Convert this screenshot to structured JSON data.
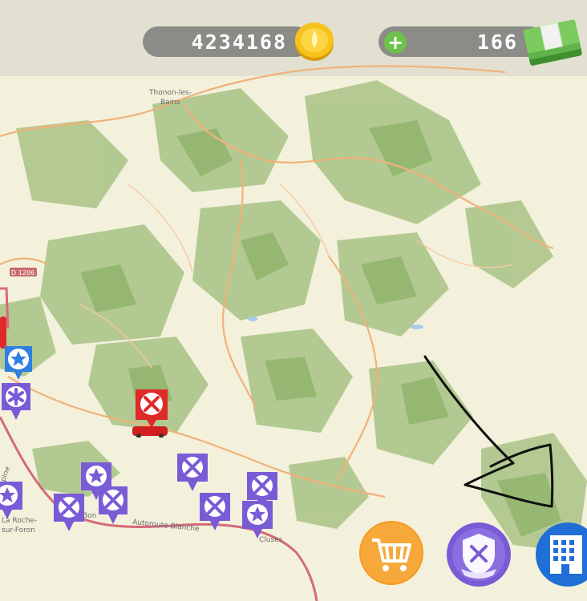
{
  "hud": {
    "coins": "4234168",
    "cash": "166",
    "add_label": "+"
  },
  "map": {
    "labels": {
      "thonon_1": "Thonon-les-",
      "thonon_2": "Bains",
      "road_d1206": "D 1206",
      "bonne": "Bon",
      "autoroute": "Autoroute Blanche",
      "cluses": "Cluses",
      "roche_1": "La Roche-",
      "roche_2": "sur-Foron",
      "alpine": "pine"
    }
  },
  "markers": [
    {
      "kind": "star",
      "color": "#2f7fe0"
    },
    {
      "kind": "medical",
      "color": "#7a5bd6"
    },
    {
      "kind": "fire",
      "color": "#e02a2a"
    },
    {
      "kind": "tools",
      "color": "#7a5bd6"
    },
    {
      "kind": "star",
      "color": "#7a5bd6"
    },
    {
      "kind": "tools",
      "color": "#7a5bd6"
    }
  ],
  "buttons": {
    "shop_icon": "cart-icon",
    "guild_icon": "shield-icon",
    "buildings_icon": "building-icon"
  },
  "colors": {
    "shop": "#f59a22",
    "guild": "#7a5bd6",
    "buildings": "#1f6fd6",
    "forest": "#9fbf7c",
    "road": "#f0b27a"
  }
}
